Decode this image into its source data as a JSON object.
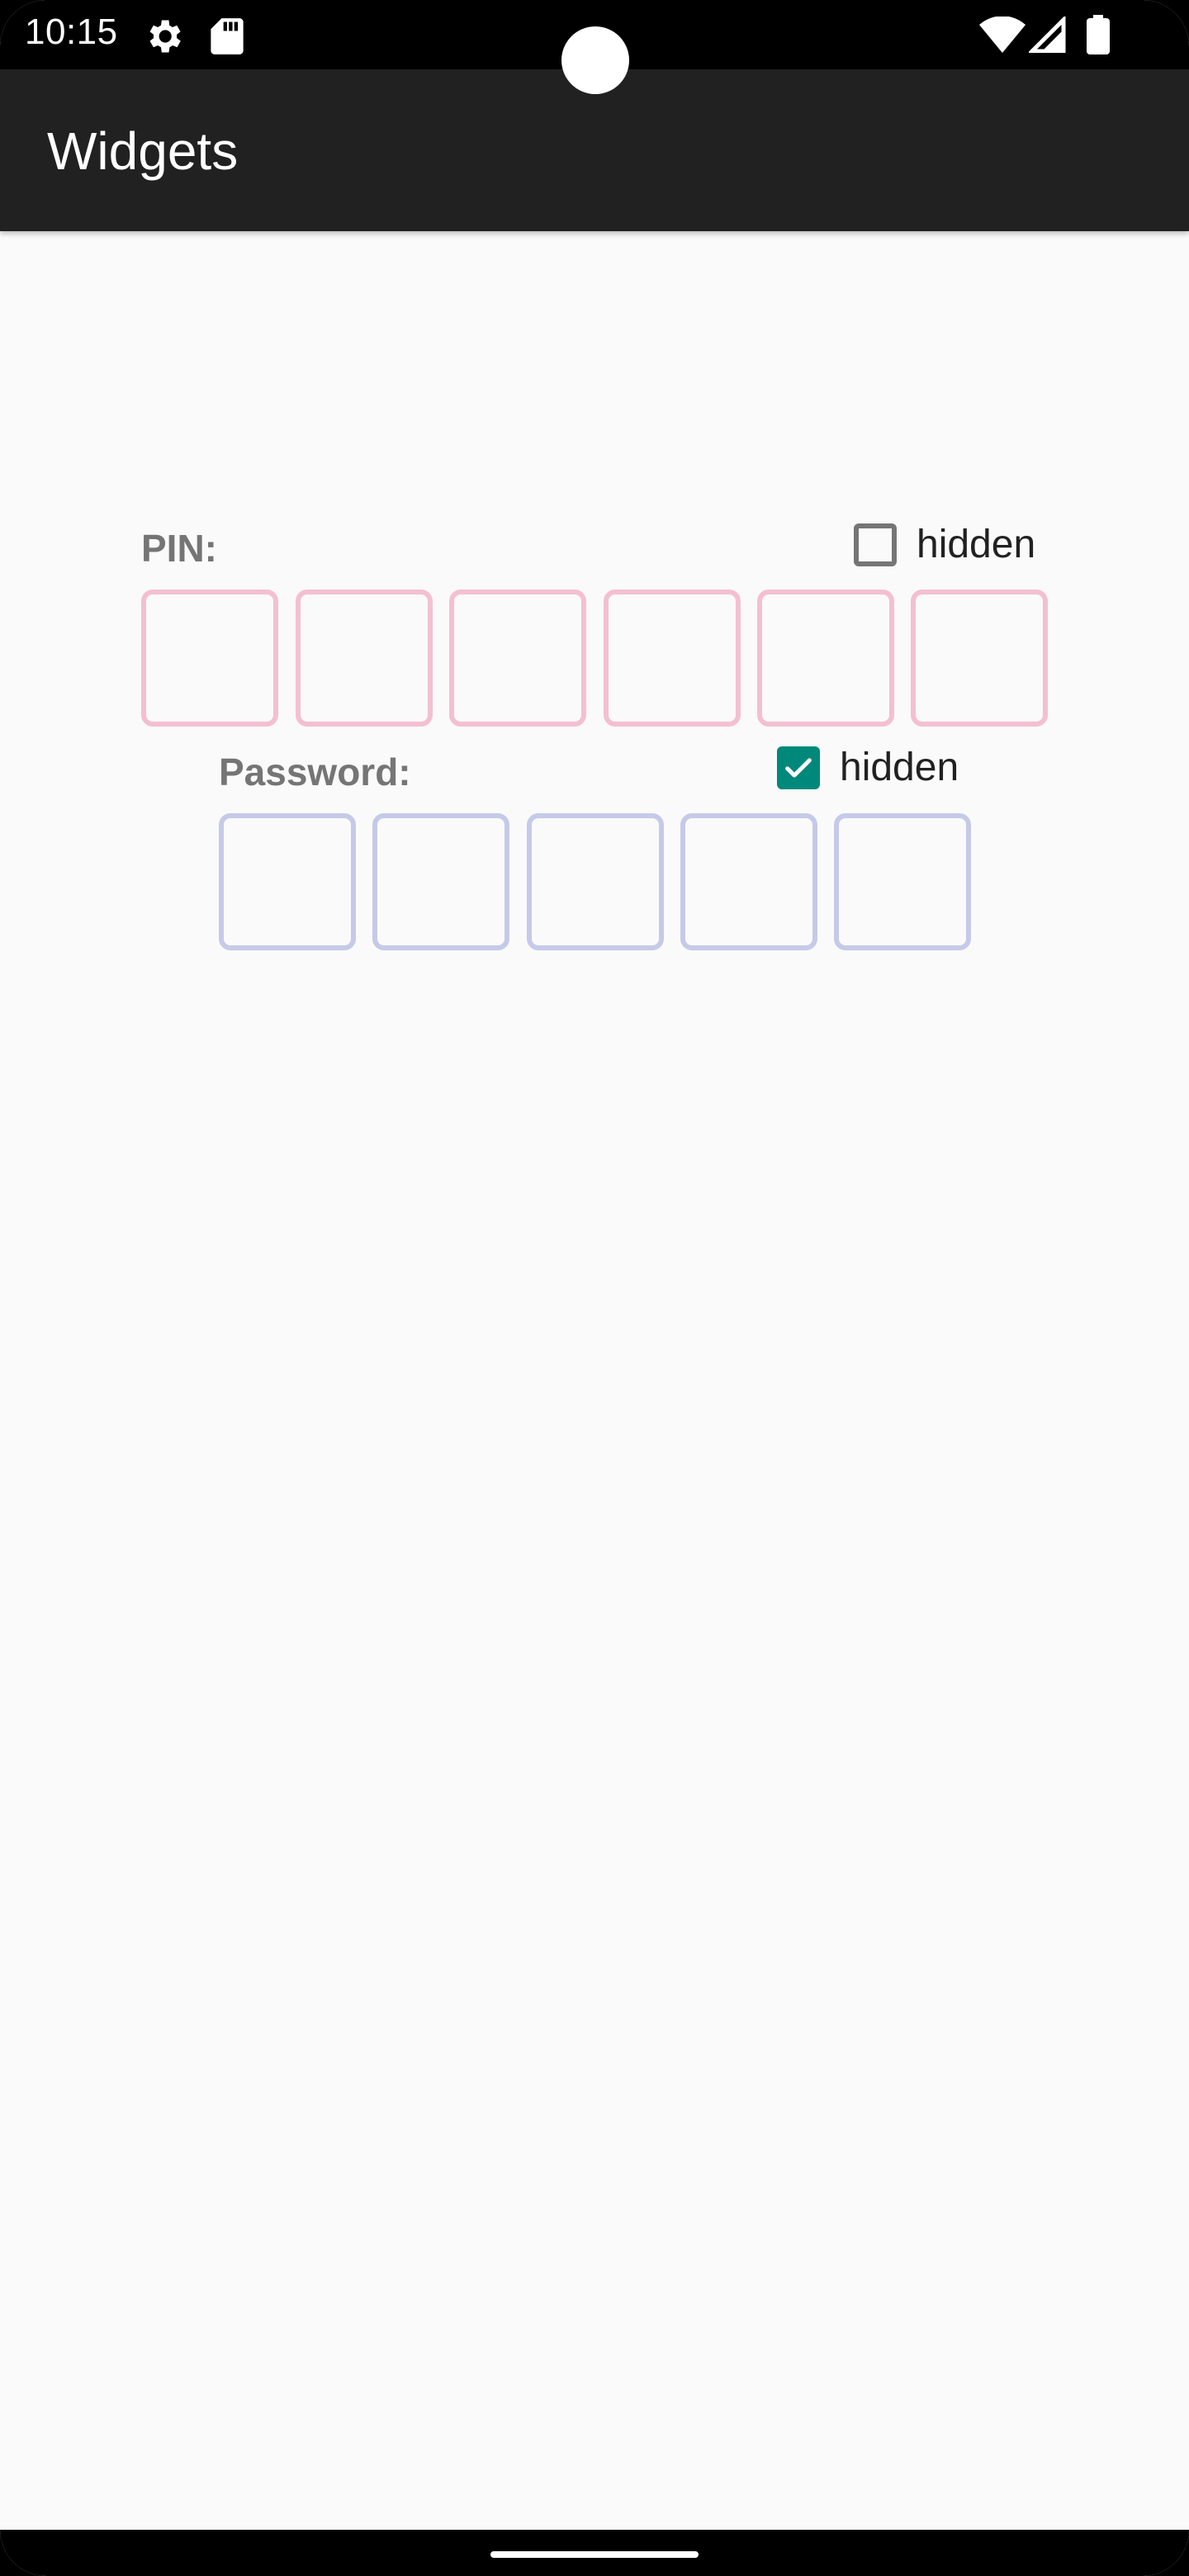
{
  "status_bar": {
    "time": "10:15",
    "left_icons": [
      "settings-gear-icon",
      "sd-card-icon"
    ],
    "right_icons": [
      "wifi-icon",
      "signal-icon",
      "battery-icon"
    ]
  },
  "app_bar": {
    "title": "Widgets"
  },
  "pin": {
    "label": "PIN:",
    "hidden_label": "hidden",
    "hidden_checked": false,
    "digits": [
      "",
      "",
      "",
      "",
      "",
      ""
    ],
    "border_color": "#f4bfd1"
  },
  "password": {
    "label": "Password:",
    "hidden_label": "hidden",
    "hidden_checked": true,
    "digits": [
      "",
      "",
      "",
      "",
      ""
    ],
    "border_color": "#c5cae9"
  },
  "colors": {
    "app_bar": "#212121",
    "checkbox_checked": "#00897b",
    "background": "#fafafa"
  }
}
